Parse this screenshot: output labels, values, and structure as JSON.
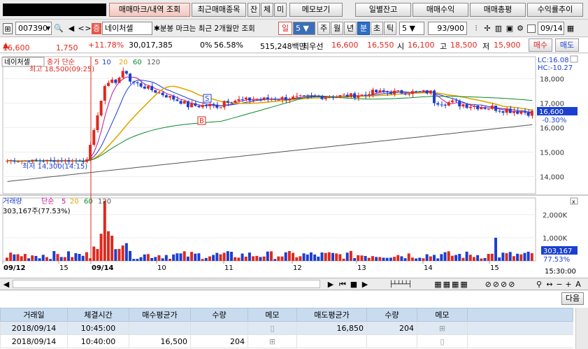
{
  "toolbar": {
    "buttons": [
      "매매마크/내역 조회",
      "최근매매종목",
      "잔",
      "체",
      "미",
      "메모보기",
      "일별잔고",
      "매매수익",
      "매매총평",
      "수익률추이"
    ]
  },
  "search": {
    "code": "007390",
    "name": "네이처셀",
    "notice": "분봉 마크는 최근 2개월만 조회",
    "period_unit": "일",
    "period_value": "5",
    "tabs": [
      "주",
      "월",
      "년",
      "분",
      "초",
      "틱"
    ],
    "minute_value": "5",
    "count": "93/900",
    "date": "09/14"
  },
  "quote": {
    "price": "16,600",
    "change": "1,750",
    "rate": "+11.78%",
    "volume": "30,017,385",
    "vol_ratio": "0%",
    "turnover": "56.58%",
    "amount": "515,248백만",
    "priority_label": "최우선",
    "ask": "16,600",
    "bid": "16,550",
    "open_label": "시",
    "open": "16,100",
    "high_label": "고",
    "high": "18,500",
    "low_label": "저",
    "low": "15,900",
    "buy": "매수",
    "sell": "매도"
  },
  "chart": {
    "stock_label": "네이처셀",
    "ma_label": "종가 단순",
    "ma_periods": [
      "5",
      "10",
      "20",
      "60",
      "120"
    ],
    "high_marker": "최고 18,500(09:25)",
    "low_marker": "최저 14,300(14:15)",
    "lc": "LC:16.08",
    "hc": "HC:-10.27",
    "price_ticks": [
      "18,000",
      "17,000",
      "16,000",
      "15,000",
      "14,000"
    ],
    "current_price": "16,600",
    "current_rate": "-0.30%",
    "vol_label": "거래량",
    "vol_ma_label": "단순",
    "vol_ma_periods": [
      "5",
      "20",
      "60",
      "120"
    ],
    "vol_value": "303,167주(77.53%)",
    "vol_ticks": [
      "2,000K",
      "1,000K"
    ],
    "vol_current": "303,167",
    "vol_rate": "77.53%",
    "x_labels": [
      "09/12",
      "15",
      "09/14",
      "10",
      "11",
      "12",
      "13",
      "14",
      "15"
    ],
    "time_label": "15:30:00",
    "markers": [
      "S",
      "B"
    ]
  },
  "grid": {
    "next_button": "다음",
    "columns": [
      "거래일",
      "체결시간",
      "매수평균가",
      "수량",
      "메모",
      "매도평균가",
      "수량",
      "메모"
    ],
    "rows": [
      [
        "2018/09/14",
        "10:45:00",
        "",
        "",
        "",
        "16,850",
        "204",
        ""
      ],
      [
        "2018/09/14",
        "10:40:00",
        "16,500",
        "204",
        "",
        "",
        "",
        ""
      ]
    ]
  },
  "chart_data": {
    "type": "candlestick",
    "title": "네이처셀",
    "ylim": [
      13300,
      18900
    ],
    "price_ticks": [
      18000,
      17000,
      16000,
      15000,
      14000
    ],
    "high": {
      "value": 18500,
      "time": "09:25"
    },
    "low": {
      "value": 14300,
      "time": "14:15"
    },
    "current": 16600,
    "volume_ticks": [
      2000,
      1000
    ],
    "volume_current": 303.167,
    "volume_max": 2600,
    "x_labels": [
      "09/12",
      "15",
      "09/14",
      "10",
      "11",
      "12",
      "13",
      "14",
      "15"
    ]
  }
}
